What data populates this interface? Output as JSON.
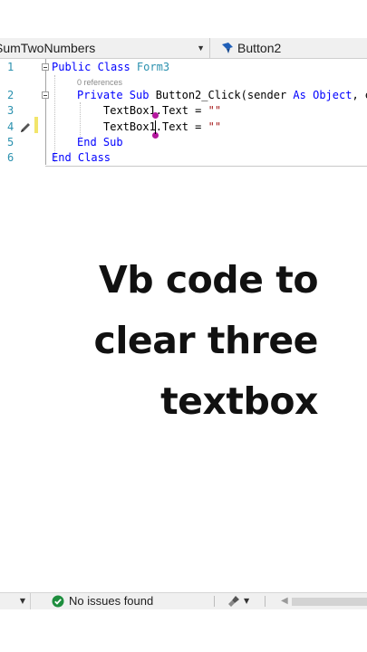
{
  "navbar": {
    "class_dropdown": "SumTwoNumbers",
    "member_dropdown": "Button2",
    "member_icon": "event-icon"
  },
  "editor": {
    "line_numbers": [
      "1",
      "2",
      "3",
      "4",
      "5",
      "6"
    ],
    "references_text": "0 references",
    "lines": {
      "l1_kw": "Public Class ",
      "l1_cls": "Form3",
      "l2_kw": "Private Sub ",
      "l2_rest": "Button2_Click(sender ",
      "l2_kw2": "As ",
      "l2_kw3": "Object",
      "l2_tail": ", e",
      "l3_code": "TextBox1.Text = ",
      "l3_str": "\"\"",
      "l4_code": "TextBox1.Text = ",
      "l4_str": "\"\"",
      "l5_kw": "End Sub",
      "l6_kw": "End Class"
    },
    "colors": {
      "keyword": "#0000ff",
      "type": "#2b91af",
      "string": "#a31515",
      "change_marker": "#f2e56b",
      "ink": "#b5179e"
    }
  },
  "caption": {
    "line1": "Vb code to",
    "line2": "clear three",
    "line3": "textbox"
  },
  "statusbar": {
    "issues_text": "No issues found",
    "issues_icon": "check-circle-icon",
    "cleanup_icon": "brush-icon"
  }
}
